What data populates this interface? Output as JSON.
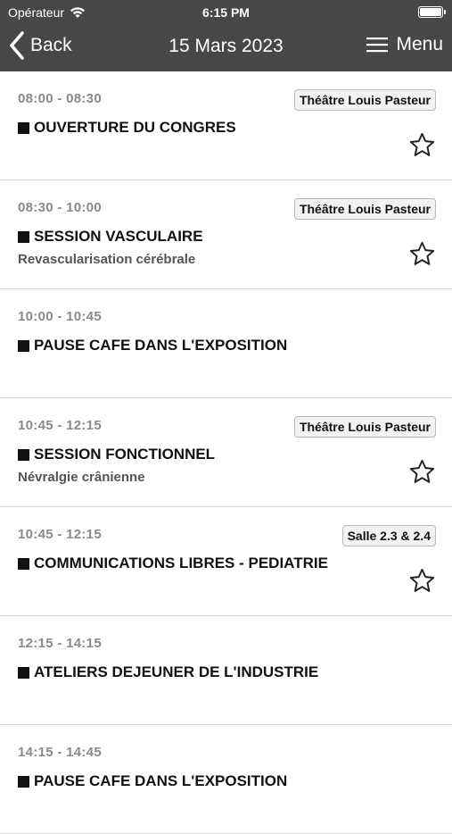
{
  "status_bar": {
    "carrier": "Opérateur",
    "time": "6:15 PM"
  },
  "nav": {
    "back_label": "Back",
    "title": "15 Mars 2023",
    "menu_label": "Menu"
  },
  "sessions": [
    {
      "time": "08:00 - 08:30",
      "room": "Théâtre Louis Pasteur",
      "title": "OUVERTURE DU CONGRES",
      "subtitle": "",
      "favorite": true
    },
    {
      "time": "08:30 - 10:00",
      "room": "Théâtre Louis Pasteur",
      "title": "SESSION VASCULAIRE",
      "subtitle": "Revascularisation cérébrale",
      "favorite": true
    },
    {
      "time": "10:00 - 10:45",
      "room": "",
      "title": "PAUSE CAFE DANS L'EXPOSITION",
      "subtitle": "",
      "favorite": false
    },
    {
      "time": "10:45 - 12:15",
      "room": "Théâtre Louis Pasteur",
      "title": "SESSION FONCTIONNEL",
      "subtitle": "Névralgie crânienne",
      "favorite": true
    },
    {
      "time": "10:45 - 12:15",
      "room": "Salle 2.3 & 2.4",
      "title": "COMMUNICATIONS LIBRES - PEDIATRIE",
      "subtitle": "",
      "favorite": true
    },
    {
      "time": "12:15 - 14:15",
      "room": "",
      "title": "ATELIERS DEJEUNER DE L'INDUSTRIE",
      "subtitle": "",
      "favorite": false
    },
    {
      "time": "14:15 - 14:45",
      "room": "",
      "title": "PAUSE CAFE DANS L'EXPOSITION",
      "subtitle": "",
      "favorite": false
    }
  ]
}
